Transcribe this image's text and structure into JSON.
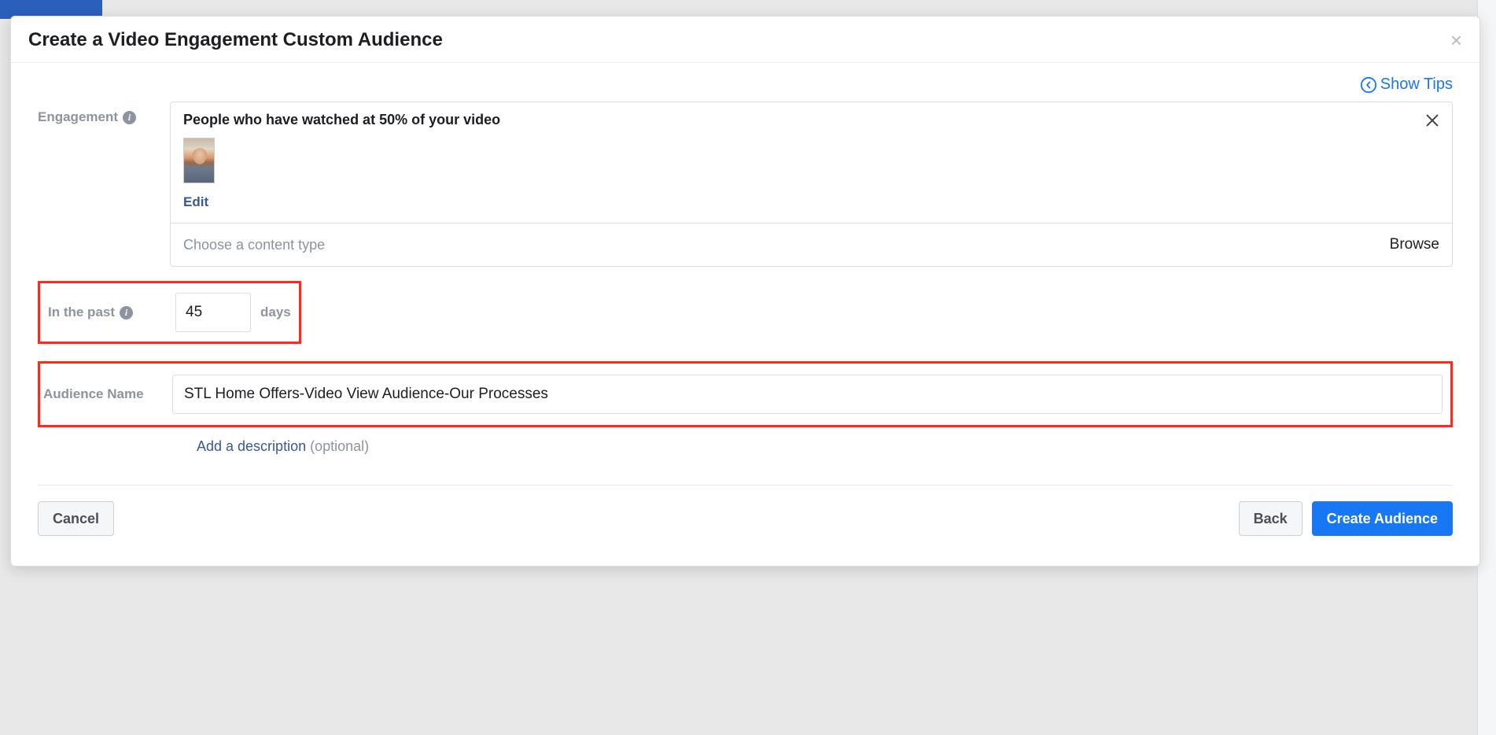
{
  "modal": {
    "title": "Create a Video Engagement Custom Audience",
    "show_tips": "Show Tips"
  },
  "labels": {
    "engagement": "Engagement",
    "in_the_past": "In the past",
    "days_suffix": "days",
    "audience_name": "Audience Name"
  },
  "engagement": {
    "criteria": "People who have watched at 50% of your video",
    "edit_label": "Edit",
    "content_type_placeholder": "Choose a content type",
    "browse_label": "Browse"
  },
  "inputs": {
    "days_value": "45",
    "audience_name_value": "STL Home Offers-Video View Audience-Our Processes"
  },
  "description": {
    "add_label": "Add a description",
    "optional": "(optional)"
  },
  "footer": {
    "cancel": "Cancel",
    "back": "Back",
    "create": "Create Audience"
  }
}
